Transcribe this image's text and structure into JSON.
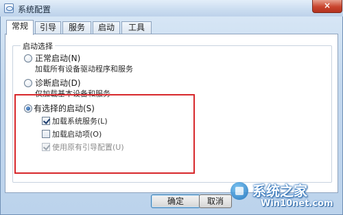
{
  "window": {
    "title": "系统配置",
    "close_label": "×"
  },
  "tabs": [
    {
      "label": "常规",
      "active": true
    },
    {
      "label": "引导",
      "active": false
    },
    {
      "label": "服务",
      "active": false
    },
    {
      "label": "启动",
      "active": false
    },
    {
      "label": "工具",
      "active": false
    }
  ],
  "startup_group": {
    "label": "启动选择",
    "options": [
      {
        "label": "正常启动(N)",
        "description": "加载所有设备驱动程序和服务",
        "selected": false
      },
      {
        "label": "诊断启动(D)",
        "description": "仅加载基本设备和服务",
        "selected": false
      },
      {
        "label": "有选择的启动(S)",
        "selected": true
      }
    ],
    "selective_items": [
      {
        "label": "加载系统服务(L)",
        "checked": true,
        "enabled": true
      },
      {
        "label": "加载启动项(O)",
        "checked": false,
        "enabled": true
      },
      {
        "label": "使用原有引导配置(U)",
        "checked": true,
        "enabled": false
      }
    ]
  },
  "buttons": {
    "ok": "确定",
    "cancel": "取消"
  },
  "watermark": {
    "title": "系统之家",
    "url": "Win10net.com"
  },
  "colors": {
    "highlight": "#d7262a",
    "window_frame": "#bcd3ec"
  }
}
